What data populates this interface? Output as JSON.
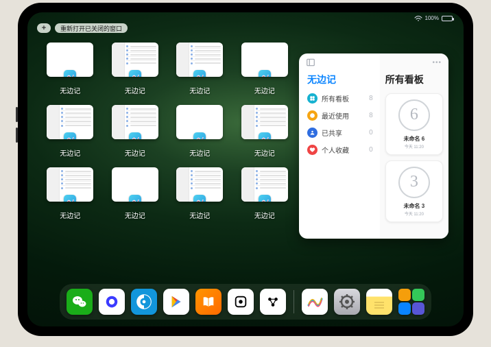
{
  "status": {
    "battery_text": "100%"
  },
  "top_left": {
    "plus": "+",
    "reopen_label": "重新打开已关闭的窗口"
  },
  "app_switcher": {
    "app_name": "无边记",
    "thumbnails": [
      {
        "label": "无边记",
        "variant": "a"
      },
      {
        "label": "无边记",
        "variant": "b"
      },
      {
        "label": "无边记",
        "variant": "b"
      },
      {
        "label": "无边记",
        "variant": "a"
      },
      {
        "label": "无边记",
        "variant": "b"
      },
      {
        "label": "无边记",
        "variant": "b"
      },
      {
        "label": "无边记",
        "variant": "a"
      },
      {
        "label": "无边记",
        "variant": "b"
      },
      {
        "label": "无边记",
        "variant": "b"
      },
      {
        "label": "无边记",
        "variant": "a"
      },
      {
        "label": "无边记",
        "variant": "b"
      },
      {
        "label": "无边记",
        "variant": "b"
      }
    ]
  },
  "slideover": {
    "left_title": "无边记",
    "right_title": "所有看板",
    "items": [
      {
        "icon": "grid",
        "color": "#16b1d0",
        "label": "所有看板",
        "count": 8
      },
      {
        "icon": "clock",
        "color": "#f6a513",
        "label": "最近使用",
        "count": 8
      },
      {
        "icon": "share",
        "color": "#2f6de0",
        "label": "已共享",
        "count": 0
      },
      {
        "icon": "heart",
        "color": "#ef4444",
        "label": "个人收藏",
        "count": 0
      }
    ],
    "boards": [
      {
        "glyph": "6",
        "name": "未命名 6",
        "time": "今天 11:20"
      },
      {
        "glyph": "3",
        "name": "未命名 3",
        "time": "今天 11:20"
      }
    ]
  },
  "dock": {
    "apps": [
      {
        "name": "wechat",
        "bg": "#1aad19"
      },
      {
        "name": "quark",
        "bg": "#ffffff"
      },
      {
        "name": "qqbrowser",
        "bg": "#1296db"
      },
      {
        "name": "play",
        "bg": "#ffffff"
      },
      {
        "name": "books",
        "bg": "linear-gradient(135deg,#ff9500,#ff6a00)"
      },
      {
        "name": "dice",
        "bg": "#ffffff"
      },
      {
        "name": "dots",
        "bg": "#ffffff"
      }
    ],
    "recent": [
      {
        "name": "freeform",
        "bg": "#ffffff"
      },
      {
        "name": "settings",
        "bg": "linear-gradient(#d9d9de,#a9a9b0)"
      },
      {
        "name": "notes",
        "bg": "linear-gradient(#fff 0 30%,#ffe26b 30% 100%)"
      }
    ],
    "library": [
      {
        "bg": "#f59e0b"
      },
      {
        "bg": "#34c759"
      },
      {
        "bg": "#0a84ff"
      },
      {
        "bg": "#5856d6"
      }
    ]
  }
}
